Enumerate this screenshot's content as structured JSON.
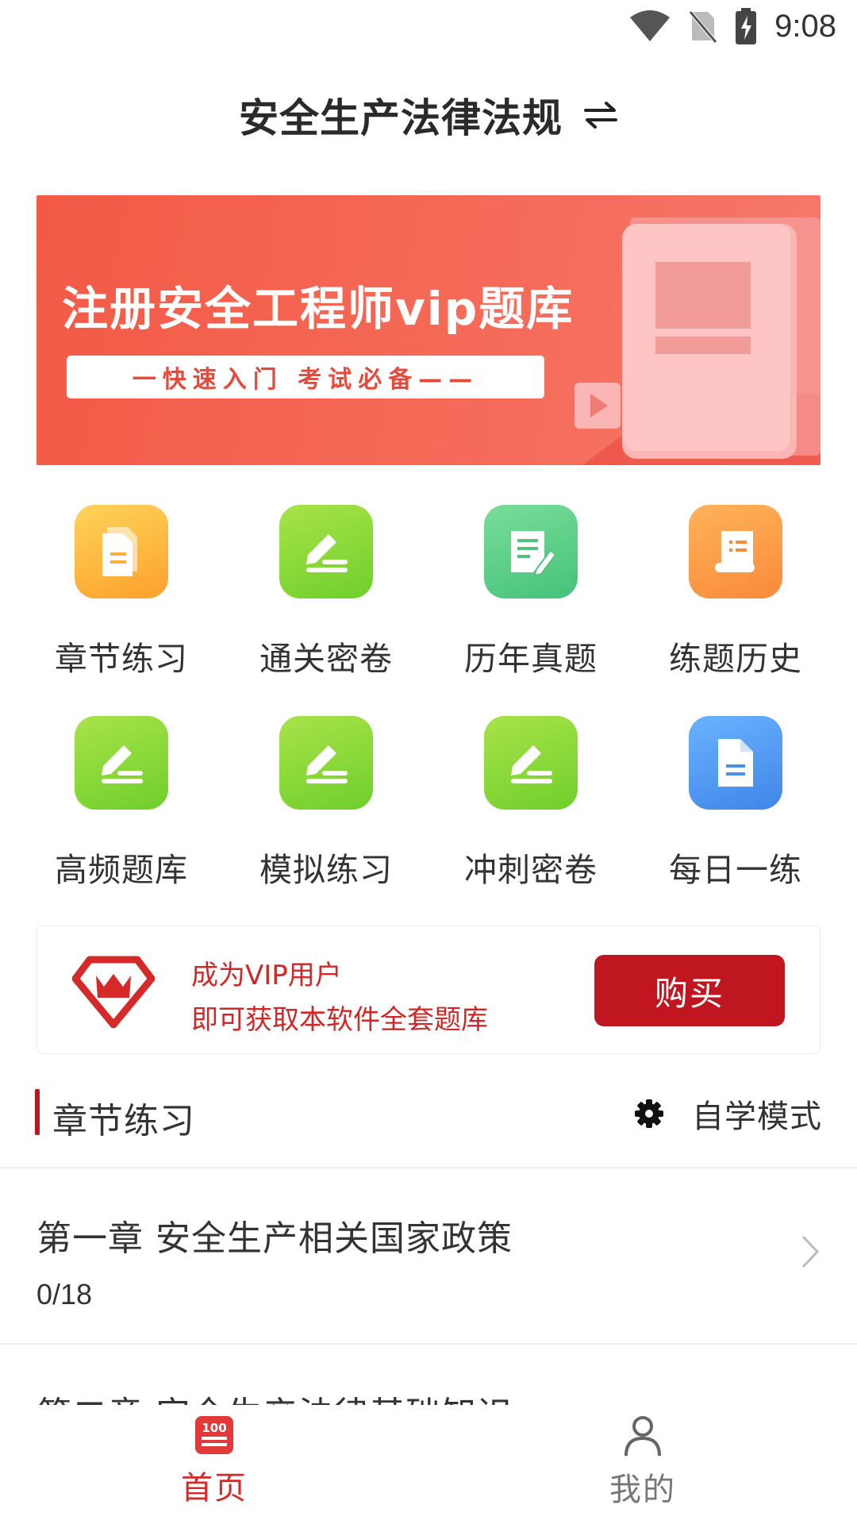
{
  "status_bar": {
    "time": "9:08"
  },
  "header": {
    "title": "安全生产法律法规",
    "switch_icon": "swap-arrows-icon"
  },
  "banner": {
    "title": "注册安全工程师vip题库",
    "subtitle": "一快速入门  考试必备——",
    "accent_color": "#f25a46"
  },
  "grid": [
    {
      "label": "章节练习",
      "icon": "document-icon",
      "color": "orange"
    },
    {
      "label": "通关密卷",
      "icon": "pen-write-icon",
      "color": "green"
    },
    {
      "label": "历年真题",
      "icon": "notepad-pen-icon",
      "color": "teal"
    },
    {
      "label": "练题历史",
      "icon": "scroll-list-icon",
      "color": "amber"
    },
    {
      "label": "高频题库",
      "icon": "pen-write-icon",
      "color": "green"
    },
    {
      "label": "模拟练习",
      "icon": "pen-write-icon",
      "color": "green"
    },
    {
      "label": "冲刺密卷",
      "icon": "pen-write-icon",
      "color": "green"
    },
    {
      "label": "每日一练",
      "icon": "file-icon",
      "color": "blue"
    }
  ],
  "vip": {
    "line1": "成为VIP用户",
    "line2": "即可获取本软件全套题库",
    "buy_label": "购买",
    "accent_color": "#c0161f"
  },
  "section": {
    "title": "章节练习",
    "mode_label": "自学模式"
  },
  "chapters": [
    {
      "title": "第一章  安全生产相关国家政策",
      "progress": "0/18"
    },
    {
      "title": "第二章  安全生产法律基础知识",
      "progress": ""
    }
  ],
  "bottom_nav": [
    {
      "label": "首页",
      "icon": "score-100-icon",
      "active": true
    },
    {
      "label": "我的",
      "icon": "person-icon",
      "active": false
    }
  ]
}
